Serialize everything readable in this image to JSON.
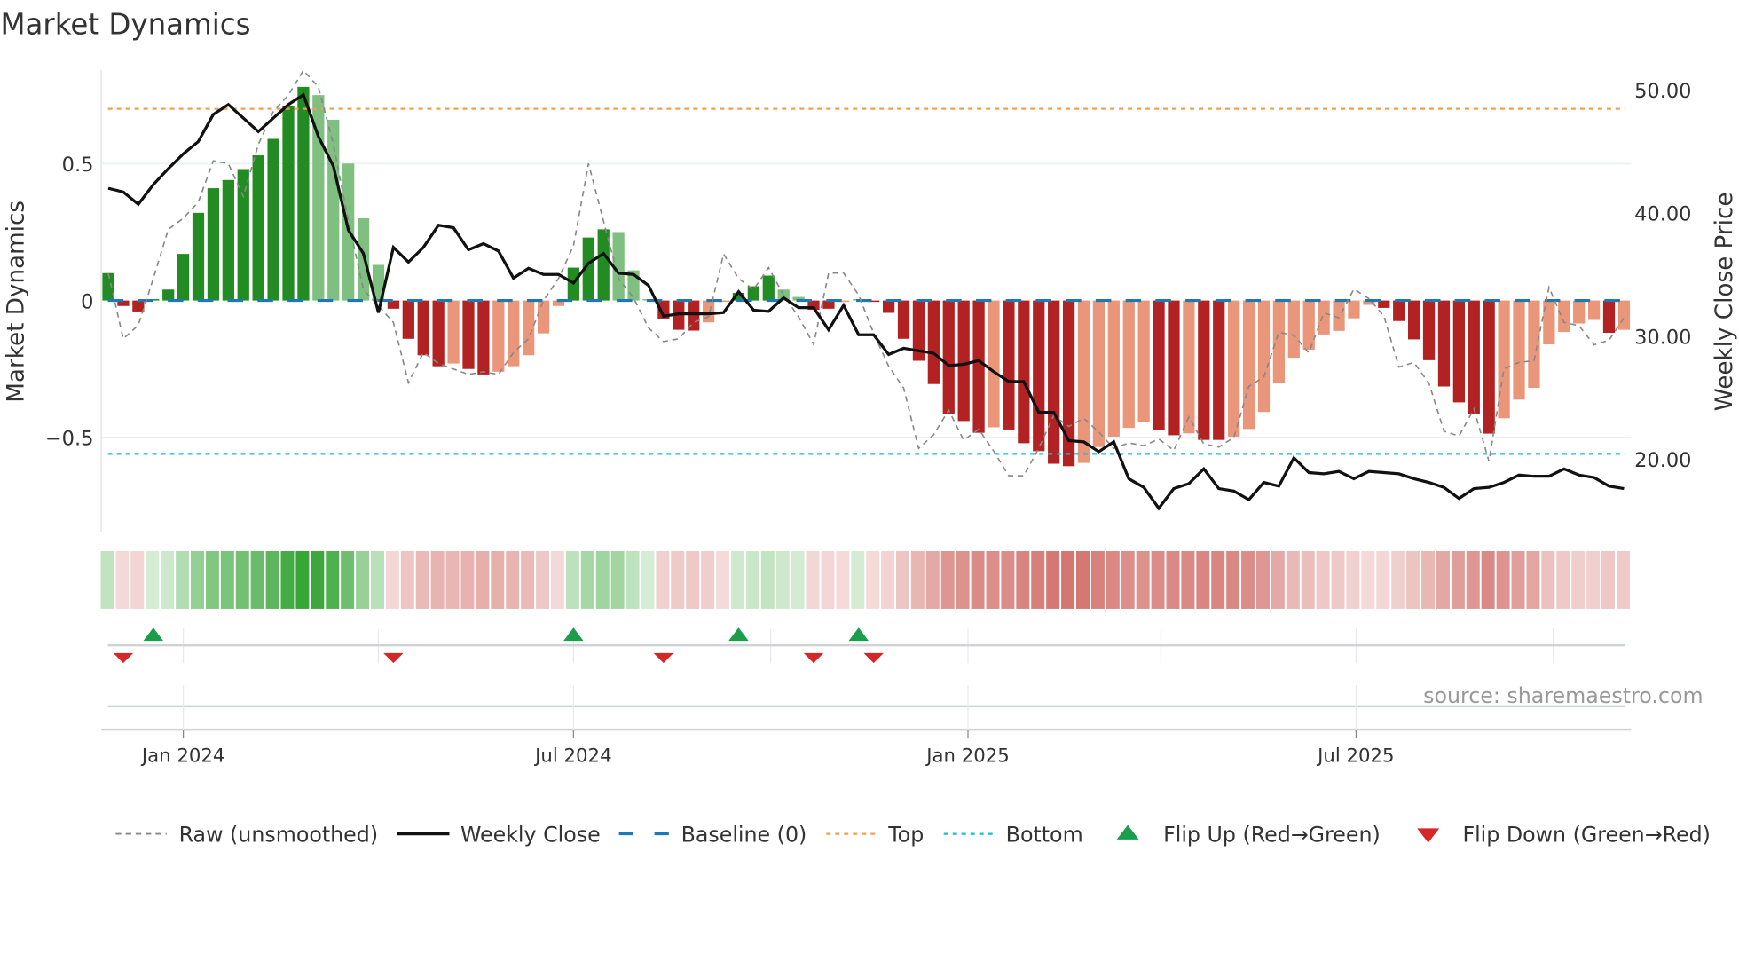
{
  "chart_data": {
    "type": "bar",
    "title": "Market Dynamics",
    "ylabel": "Market Dynamics",
    "y2label": "Weekly Close Price",
    "source": "source: sharemaestro.com",
    "ylim": [
      -0.78,
      0.84
    ],
    "y2lim": [
      14.5,
      51.7
    ],
    "yticks": [
      {
        "v": 0.5,
        "label": "0.5"
      },
      {
        "v": 0,
        "label": "0"
      },
      {
        "v": -0.5,
        "label": "−0.5"
      }
    ],
    "y2ticks": [
      {
        "v": 50,
        "label": "50.00"
      },
      {
        "v": 40,
        "label": "40.00"
      },
      {
        "v": 30,
        "label": "30.00"
      },
      {
        "v": 20,
        "label": "20.00"
      }
    ],
    "xticks": [
      {
        "date": "2024-01-01",
        "label": "Jan 2024"
      },
      {
        "date": "2024-07-01",
        "label": "Jul 2024"
      },
      {
        "date": "2025-01-01",
        "label": "Jan 2025"
      },
      {
        "date": "2025-07-01",
        "label": "Jul 2025"
      }
    ],
    "quarter_grid": [
      "2024-01-01",
      "2024-04-01",
      "2024-07-01",
      "2024-10-01",
      "2025-01-01",
      "2025-04-01",
      "2025-07-01",
      "2025-10-01"
    ],
    "x_start": "2023-11-27",
    "x_step_days": 7,
    "top": 0.7,
    "bottom": -0.56,
    "baseline": 0,
    "colors": {
      "pos_strong": "#228b22",
      "pos_weak": "#7fbf7f",
      "neg_strong": "#b22222",
      "neg_weak": "#e9967a",
      "baseline": "#1f77b4",
      "top": "#f0a050",
      "bottom": "#17becf",
      "raw": "#888888",
      "close": "#111111",
      "flip_up": "#1a9e4a",
      "flip_down": "#d62728",
      "strip_pos": "#2ca02c",
      "strip_neg": "#c8504a"
    },
    "series": [
      {
        "name": "Market Dynamics",
        "shade": "DDDDDDDDDDDDDDLLLLLDDDDLDDLLLLLDDDLLLDDDLLDDDLLDDLLDDDDDDDDLDDDDDLLLLLDDLDDLLLLLLLLLLDDDDDDDDLLLLLLLDL",
        "values": [
          0.1,
          -0.02,
          -0.04,
          0.005,
          0.04,
          0.17,
          0.32,
          0.41,
          0.44,
          0.48,
          0.53,
          0.59,
          0.71,
          0.78,
          0.75,
          0.66,
          0.5,
          0.3,
          0.13,
          -0.03,
          -0.14,
          -0.2,
          -0.24,
          -0.23,
          -0.25,
          -0.27,
          -0.26,
          -0.24,
          -0.2,
          -0.12,
          -0.02,
          0.12,
          0.23,
          0.26,
          0.25,
          0.11,
          0.005,
          -0.066,
          -0.107,
          -0.11,
          -0.08,
          -0.005,
          0.028,
          0.052,
          0.091,
          0.04,
          0.013,
          -0.034,
          -0.03,
          -0.005,
          0.005,
          -0.005,
          -0.045,
          -0.14,
          -0.22,
          -0.305,
          -0.416,
          -0.44,
          -0.483,
          -0.463,
          -0.471,
          -0.521,
          -0.55,
          -0.596,
          -0.605,
          -0.593,
          -0.535,
          -0.497,
          -0.465,
          -0.445,
          -0.474,
          -0.492,
          -0.485,
          -0.509,
          -0.509,
          -0.497,
          -0.469,
          -0.407,
          -0.302,
          -0.209,
          -0.18,
          -0.124,
          -0.111,
          -0.065,
          -0.016,
          -0.027,
          -0.075,
          -0.142,
          -0.218,
          -0.314,
          -0.372,
          -0.413,
          -0.486,
          -0.43,
          -0.362,
          -0.319,
          -0.16,
          -0.115,
          -0.084,
          -0.071,
          -0.118,
          -0.107
        ]
      },
      {
        "name": "Raw (unsmoothed)",
        "values": [
          0.1,
          -0.14,
          -0.09,
          0.08,
          0.26,
          0.3,
          0.36,
          0.51,
          0.5,
          0.38,
          0.57,
          0.69,
          0.75,
          0.84,
          0.78,
          0.57,
          0.29,
          0.04,
          -0.02,
          -0.08,
          -0.3,
          -0.19,
          -0.23,
          -0.25,
          -0.27,
          -0.26,
          -0.27,
          -0.19,
          -0.14,
          0.0,
          0.08,
          0.2,
          0.5,
          0.29,
          0.08,
          0.01,
          -0.1,
          -0.15,
          -0.14,
          -0.08,
          -0.06,
          0.17,
          0.08,
          0.04,
          0.12,
          0.02,
          -0.06,
          -0.16,
          0.1,
          0.1,
          0.02,
          -0.12,
          -0.24,
          -0.32,
          -0.54,
          -0.49,
          -0.4,
          -0.51,
          -0.47,
          -0.55,
          -0.64,
          -0.64,
          -0.54,
          -0.42,
          -0.46,
          -0.43,
          -0.48,
          -0.54,
          -0.52,
          -0.53,
          -0.506,
          -0.547,
          -0.425,
          -0.524,
          -0.535,
          -0.5,
          -0.314,
          -0.279,
          -0.116,
          -0.127,
          -0.191,
          -0.045,
          -0.063,
          0.042,
          0.007,
          -0.057,
          -0.243,
          -0.226,
          -0.302,
          -0.477,
          -0.495,
          -0.396,
          -0.587,
          -0.249,
          -0.226,
          -0.22,
          0.048,
          -0.08,
          -0.092,
          -0.162,
          -0.145,
          -0.063
        ]
      },
      {
        "name": "Weekly Close",
        "axis": "right",
        "values": [
          42.0,
          41.7,
          40.7,
          42.3,
          43.6,
          44.8,
          45.8,
          48.0,
          48.8,
          47.7,
          46.6,
          47.7,
          48.8,
          49.6,
          46.2,
          43.8,
          38.6,
          36.7,
          31.9,
          37.2,
          36.0,
          37.2,
          39.0,
          38.8,
          37.0,
          37.5,
          36.9,
          34.7,
          35.5,
          35.0,
          35.0,
          34.3,
          35.9,
          36.7,
          35.1,
          35.0,
          34.1,
          31.6,
          31.8,
          31.8,
          31.8,
          31.9,
          33.6,
          32.1,
          32.0,
          33.1,
          32.3,
          32.3,
          30.5,
          32.5,
          30.1,
          30.1,
          28.5,
          29.0,
          28.8,
          28.6,
          27.6,
          27.7,
          28.0,
          27.1,
          26.3,
          26.3,
          23.8,
          23.8,
          21.5,
          21.4,
          20.6,
          21.4,
          18.4,
          17.7,
          16.0,
          17.6,
          18.0,
          19.2,
          17.6,
          17.4,
          16.7,
          18.1,
          17.8,
          20.1,
          18.9,
          18.8,
          19.0,
          18.4,
          19.0,
          18.9,
          18.8,
          18.4,
          18.1,
          17.7,
          16.8,
          17.6,
          17.7,
          18.1,
          18.7,
          18.6,
          18.6,
          19.2,
          18.7,
          18.5,
          17.8,
          17.6
        ]
      }
    ],
    "flips_up": [
      3,
      31,
      42,
      50
    ],
    "flips_down": [
      1,
      19,
      37,
      47,
      51
    ],
    "legend": {
      "placement": "bottom",
      "items": [
        {
          "key": "raw",
          "label": "Raw (unsmoothed)"
        },
        {
          "key": "close",
          "label": "Weekly Close"
        },
        {
          "key": "baseline",
          "label": "Baseline (0)"
        },
        {
          "key": "top",
          "label": "Top"
        },
        {
          "key": "bottom",
          "label": "Bottom"
        },
        {
          "key": "flip_up",
          "label": "Flip Up (Red→Green)"
        },
        {
          "key": "flip_down",
          "label": "Flip Down (Green→Red)"
        }
      ]
    }
  }
}
